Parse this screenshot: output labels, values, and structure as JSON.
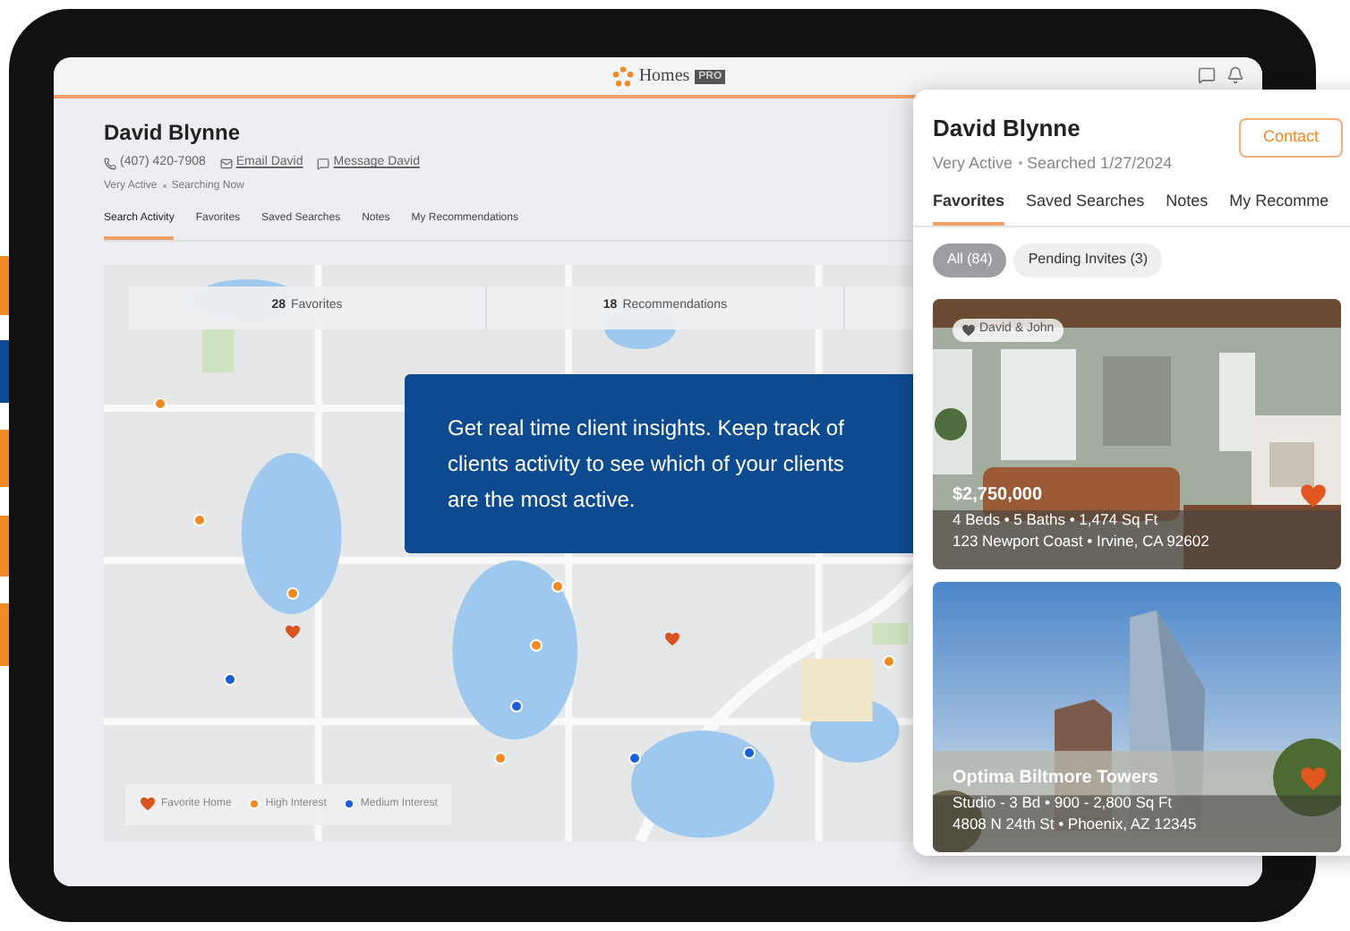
{
  "app": {
    "logo_text": "Homes",
    "logo_badge": "PRO"
  },
  "client": {
    "name": "David Blynne",
    "phone": "(407) 420-7908",
    "email_link": "Email David",
    "message_link": "Message David",
    "status": "Very Active",
    "activity": "Searching Now"
  },
  "tabs": [
    {
      "label": "Search Activity",
      "selected": true
    },
    {
      "label": "Favorites",
      "selected": false
    },
    {
      "label": "Saved Searches",
      "selected": false
    },
    {
      "label": "Notes",
      "selected": false
    },
    {
      "label": "My Recommendations",
      "selected": false
    }
  ],
  "map": {
    "stats": [
      {
        "count": "28",
        "label": "Favorites"
      },
      {
        "count": "18",
        "label": "Recommendations"
      }
    ],
    "markers": [
      {
        "kind": "high"
      },
      {
        "kind": "high"
      },
      {
        "kind": "high"
      },
      {
        "kind": "high"
      },
      {
        "kind": "high"
      },
      {
        "kind": "high"
      },
      {
        "kind": "high"
      },
      {
        "kind": "favorite"
      },
      {
        "kind": "favorite"
      },
      {
        "kind": "medium"
      },
      {
        "kind": "medium"
      },
      {
        "kind": "medium"
      },
      {
        "kind": "medium"
      }
    ],
    "legend": [
      {
        "kind": "favorite",
        "label": "Favorite Home"
      },
      {
        "kind": "high",
        "label": "High Interest"
      },
      {
        "kind": "medium",
        "label": "Medium Interest"
      }
    ]
  },
  "callout": "Get real time client insights. Keep track of clients activity to see which of your clients are the most active.",
  "panel": {
    "name": "David Blynne",
    "status": "Very Active",
    "searched": "Searched 1/27/2024",
    "contact_button": "Contact",
    "tabs": [
      {
        "label": "Favorites",
        "selected": true
      },
      {
        "label": "Saved Searches",
        "selected": false
      },
      {
        "label": "Notes",
        "selected": false
      },
      {
        "label": "My Recomme",
        "selected": false
      }
    ],
    "filters": [
      {
        "label": "All (84)",
        "selected": true
      },
      {
        "label": "Pending Invites (3)",
        "selected": false
      }
    ],
    "listings": [
      {
        "tag": "David & John",
        "title": "$2,750,000",
        "details": "4 Beds • 5 Baths • 1,474 Sq Ft",
        "address": "123 Newport Coast • Irvine, CA 92602",
        "favorited": true
      },
      {
        "title": "Optima Biltmore Towers",
        "details": "Studio - 3 Bd • 900 - 2,800 Sq Ft",
        "address": "4808 N 24th St • Phoenix, AZ 12345",
        "favorited": true
      }
    ]
  }
}
